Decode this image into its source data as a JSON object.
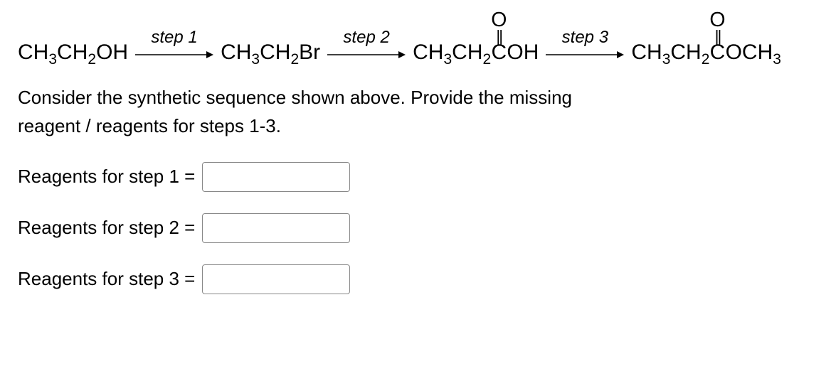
{
  "reaction": {
    "compound1_parts": [
      "CH",
      "3",
      "CH",
      "2",
      "OH"
    ],
    "compound2_parts": [
      "CH",
      "3",
      "CH",
      "2",
      "Br"
    ],
    "compound3_parts_prefix": [
      "CH",
      "3",
      "CH",
      "2"
    ],
    "compound3_oxygen": "O",
    "compound3_dbond": "||",
    "compound3_base": "C",
    "compound3_parts_suffix": [
      "OH"
    ],
    "compound4_parts_prefix": [
      "CH",
      "3",
      "CH",
      "2"
    ],
    "compound4_oxygen": "O",
    "compound4_dbond": "||",
    "compound4_base": "C",
    "compound4_parts_suffix": [
      "OCH",
      "3"
    ],
    "step1_label": "step 1",
    "step2_label": "step 2",
    "step3_label": "step 3"
  },
  "question": {
    "line1": "Consider the synthetic sequence shown above.  Provide the missing",
    "line2": "reagent / reagents for steps 1-3."
  },
  "inputs": {
    "label1": "Reagents for step 1 =",
    "label2": "Reagents for step 2 =",
    "label3": "Reagents for step 3 =",
    "value1": "",
    "value2": "",
    "value3": ""
  }
}
